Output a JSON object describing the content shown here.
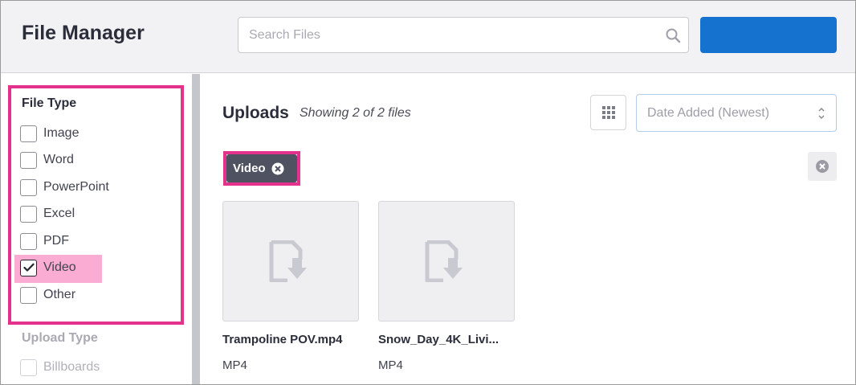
{
  "header": {
    "title": "File Manager",
    "search_placeholder": "Search Files",
    "search_value": "",
    "primary_button_label": ""
  },
  "sidebar": {
    "file_type_title": "File Type",
    "file_types": [
      {
        "label": "Image",
        "checked": false
      },
      {
        "label": "Word",
        "checked": false
      },
      {
        "label": "PowerPoint",
        "checked": false
      },
      {
        "label": "Excel",
        "checked": false
      },
      {
        "label": "PDF",
        "checked": false
      },
      {
        "label": "Video",
        "checked": true
      },
      {
        "label": "Other",
        "checked": false
      }
    ],
    "upload_type_title": "Upload Type",
    "upload_types": [
      {
        "label": "Billboards",
        "checked": false,
        "disabled": true
      }
    ]
  },
  "main": {
    "title": "Uploads",
    "showing": "Showing 2 of 2 files",
    "view_toggle_icon": "grid-icon",
    "sort": {
      "value": "Date Added (Newest)"
    },
    "active_filter": {
      "label": "Video"
    },
    "files": [
      {
        "name": "Trampoline POV.mp4",
        "type": "MP4"
      },
      {
        "name": "Snow_Day_4K_Livi...",
        "type": "MP4"
      }
    ]
  },
  "colors": {
    "accent": "#1572cf",
    "highlight": "#e4318c",
    "highlight_fill": "#fbacd3",
    "chip": "#4f5261"
  }
}
